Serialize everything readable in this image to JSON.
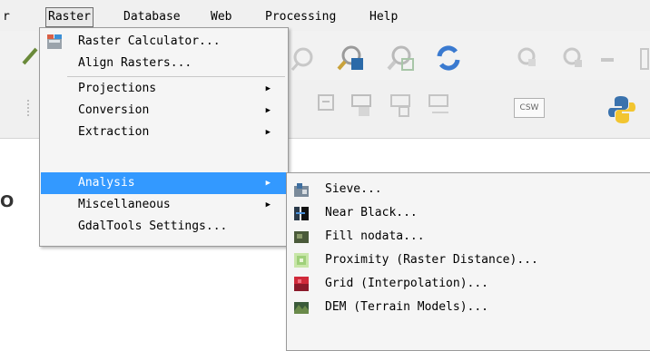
{
  "menubar": {
    "items": [
      {
        "label": "r"
      },
      {
        "label": "Raster"
      },
      {
        "label": "Database"
      },
      {
        "label": "Web"
      },
      {
        "label": "Processing"
      },
      {
        "label": "Help"
      }
    ]
  },
  "toolbar": {
    "csw_label": "CSW"
  },
  "raster_menu": {
    "items": [
      {
        "label": "Raster Calculator..."
      },
      {
        "label": "Align Rasters..."
      },
      {
        "label": "Projections"
      },
      {
        "label": "Conversion"
      },
      {
        "label": "Extraction"
      },
      {
        "label": "Analysis"
      },
      {
        "label": "Miscellaneous"
      },
      {
        "label": "GdalTools Settings..."
      }
    ],
    "submenu_arrow": "▶"
  },
  "analysis_submenu": {
    "items": [
      {
        "label": "Sieve..."
      },
      {
        "label": "Near Black..."
      },
      {
        "label": "Fill nodata..."
      },
      {
        "label": "Proximity (Raster Distance)..."
      },
      {
        "label": "Grid (Interpolation)..."
      },
      {
        "label": "DEM (Terrain Models)..."
      }
    ]
  },
  "panel": {
    "letter": "O"
  },
  "colors": {
    "highlight": "#3399ff",
    "menu_bg": "#f5f5f5"
  }
}
